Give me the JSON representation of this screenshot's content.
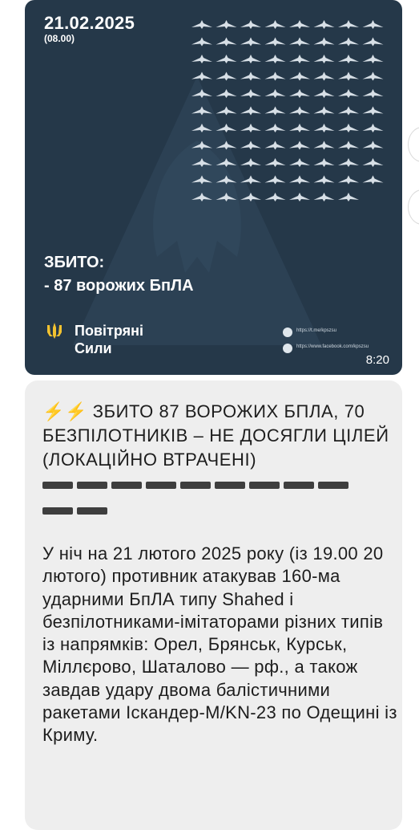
{
  "post_image": {
    "date": "21.02.2025",
    "time_small": "(08.00)",
    "shot_down_label": "ЗБИТО:",
    "shot_down_count": "- 87 ворожих БпЛА",
    "logo_line1": "Повітряні",
    "logo_line2": "Сили",
    "telegram_link": "https://t.me/kpszsu",
    "facebook_link": "https://www.facebook.com/kpszsu",
    "drone_icon_name": "drone-icon",
    "logo_icon_name": "trident-icon",
    "timestamp": "8:20",
    "colors": {
      "card_bg": "#253849",
      "drone": "#d7dfe6"
    }
  },
  "message": {
    "bolt_icons": "⚡⚡",
    "headline": "ЗБИТО 87 ВОРОЖИХ БПЛА, 70 БЕЗПІЛОТНИКІВ – НЕ ДОСЯГЛИ ЦІЛЕЙ (ЛОКАЦІЙНО ВТРАЧЕНІ)",
    "separator_count": 11,
    "body": "У ніч на 21 лютого 2025 року (із 19.00 20 лютого) противник атакував 160-ма ударними БпЛА типу Shahed і безпілотниками-імітаторами різних типів із напрямків: Орел, Брянськ, Курськ, Міллєрово, Шаталово — рф., а також завдав удару двома балістичними ракетами Іскандер-М/KN-23 по Одещині із Криму.",
    "colors": {
      "bubble_bg": "#eeeeee",
      "text": "#1d1d1d",
      "bolt": "#f6b400"
    }
  }
}
